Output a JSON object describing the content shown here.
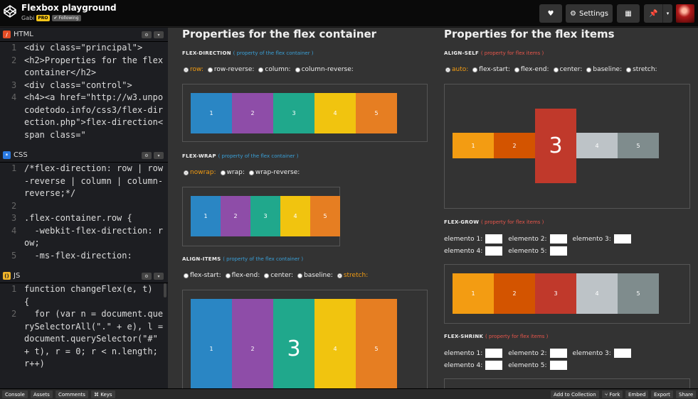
{
  "header": {
    "title": "Flexbox playground",
    "author": "Gabi",
    "pro_badge": "PRO",
    "following_badge": "✔ Following",
    "settings_label": "Settings"
  },
  "editors": {
    "html": {
      "label": "HTML",
      "lines": [
        {
          "n": "1",
          "t": "<div class=\"principal\">"
        },
        {
          "n": "2",
          "t": "<h2>Properties for the flex container</h2>"
        },
        {
          "n": "3",
          "t": "<div class=\"control\">"
        },
        {
          "n": "4",
          "t": "<h4><a href=\"http://w3.unpocodetodo.info/css3/flex-direction.php\">flex-direction<span class=\""
        }
      ]
    },
    "css": {
      "label": "CSS",
      "lines": [
        {
          "n": "1",
          "t": "/*flex-direction: row | row-reverse | column | column-reverse;*/"
        },
        {
          "n": "2",
          "t": ""
        },
        {
          "n": "3",
          "t": ".flex-container.row {"
        },
        {
          "n": "4",
          "t": "  -webkit-flex-direction: row;"
        },
        {
          "n": "5",
          "t": "  -ms-flex-direction:"
        }
      ]
    },
    "js": {
      "label": "JS",
      "lines": [
        {
          "n": "1",
          "t": "function changeFlex(e, t)"
        },
        {
          "n": "",
          "t": "{"
        },
        {
          "n": "2",
          "t": "  for (var n = document.querySelectorAll(\".\" + e), l = document.querySelector(\"#\" + t), r = 0; r < n.length; r++)"
        }
      ]
    }
  },
  "output": {
    "container_title": "Properties for the flex container",
    "items_title": "Properties for the flex items",
    "container_note": "( property of the flex container )",
    "items_note": "( property for flex items )",
    "sections": {
      "flex_direction": {
        "label": "FLEX-DIRECTION",
        "options": [
          "row:",
          "row-reverse:",
          "column:",
          "column-reverse:"
        ],
        "selected": 0
      },
      "flex_wrap": {
        "label": "FLEX-WRAP",
        "options": [
          "nowrap:",
          "wrap:",
          "wrap-reverse:"
        ],
        "selected": 0
      },
      "align_items": {
        "label": "ALIGN-ITEMS",
        "options": [
          "flex-start:",
          "flex-end:",
          "center:",
          "baseline:",
          "stretch:"
        ],
        "selected": 4
      },
      "align_self": {
        "label": "ALIGN-SELF",
        "options": [
          "auto:",
          "flex-start:",
          "flex-end:",
          "center:",
          "baseline:",
          "stretch:"
        ],
        "selected": 0
      },
      "flex_grow": {
        "label": "FLEX-GROW",
        "fields": [
          "elemento 1:",
          "elemento 2:",
          "elemento 3:",
          "elemento 4:",
          "elemento 5:"
        ]
      },
      "flex_shrink": {
        "label": "FLEX-SHRINK",
        "fields": [
          "elemento 1:",
          "elemento 2:",
          "elemento 3:",
          "elemento 4:",
          "elemento 5:"
        ]
      }
    },
    "item_labels": [
      "1",
      "2",
      "3",
      "4",
      "5"
    ],
    "colors_container": [
      "#2a86c4",
      "#8e4da8",
      "#20a88c",
      "#f1c40f",
      "#e67e22"
    ],
    "colors_items": [
      "#f39c12",
      "#d35400",
      "#c0392b",
      "#bdc3c7",
      "#7f8c8d"
    ]
  },
  "footer": {
    "left": [
      "Console",
      "Assets",
      "Comments",
      "⌘ Keys"
    ],
    "right": [
      "Add to Collection",
      "⑂ Fork",
      "Embed",
      "Export",
      "Share"
    ]
  }
}
